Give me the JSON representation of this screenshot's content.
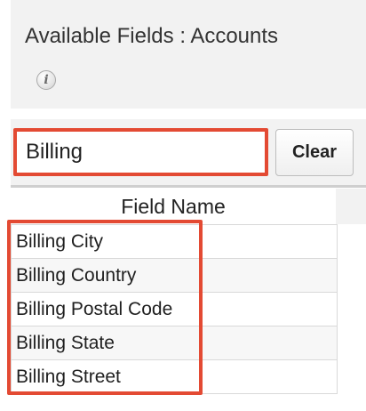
{
  "header": {
    "title": "Available Fields : Accounts",
    "info_icon": "info-icon"
  },
  "search": {
    "value": "Billing",
    "clear_label": "Clear"
  },
  "table": {
    "column_header": "Field Name",
    "rows": [
      "Billing City",
      "Billing Country",
      "Billing Postal Code",
      "Billing State",
      "Billing Street"
    ]
  },
  "colors": {
    "callout": "#e34a33",
    "panel_bg": "#f2f2f2"
  }
}
